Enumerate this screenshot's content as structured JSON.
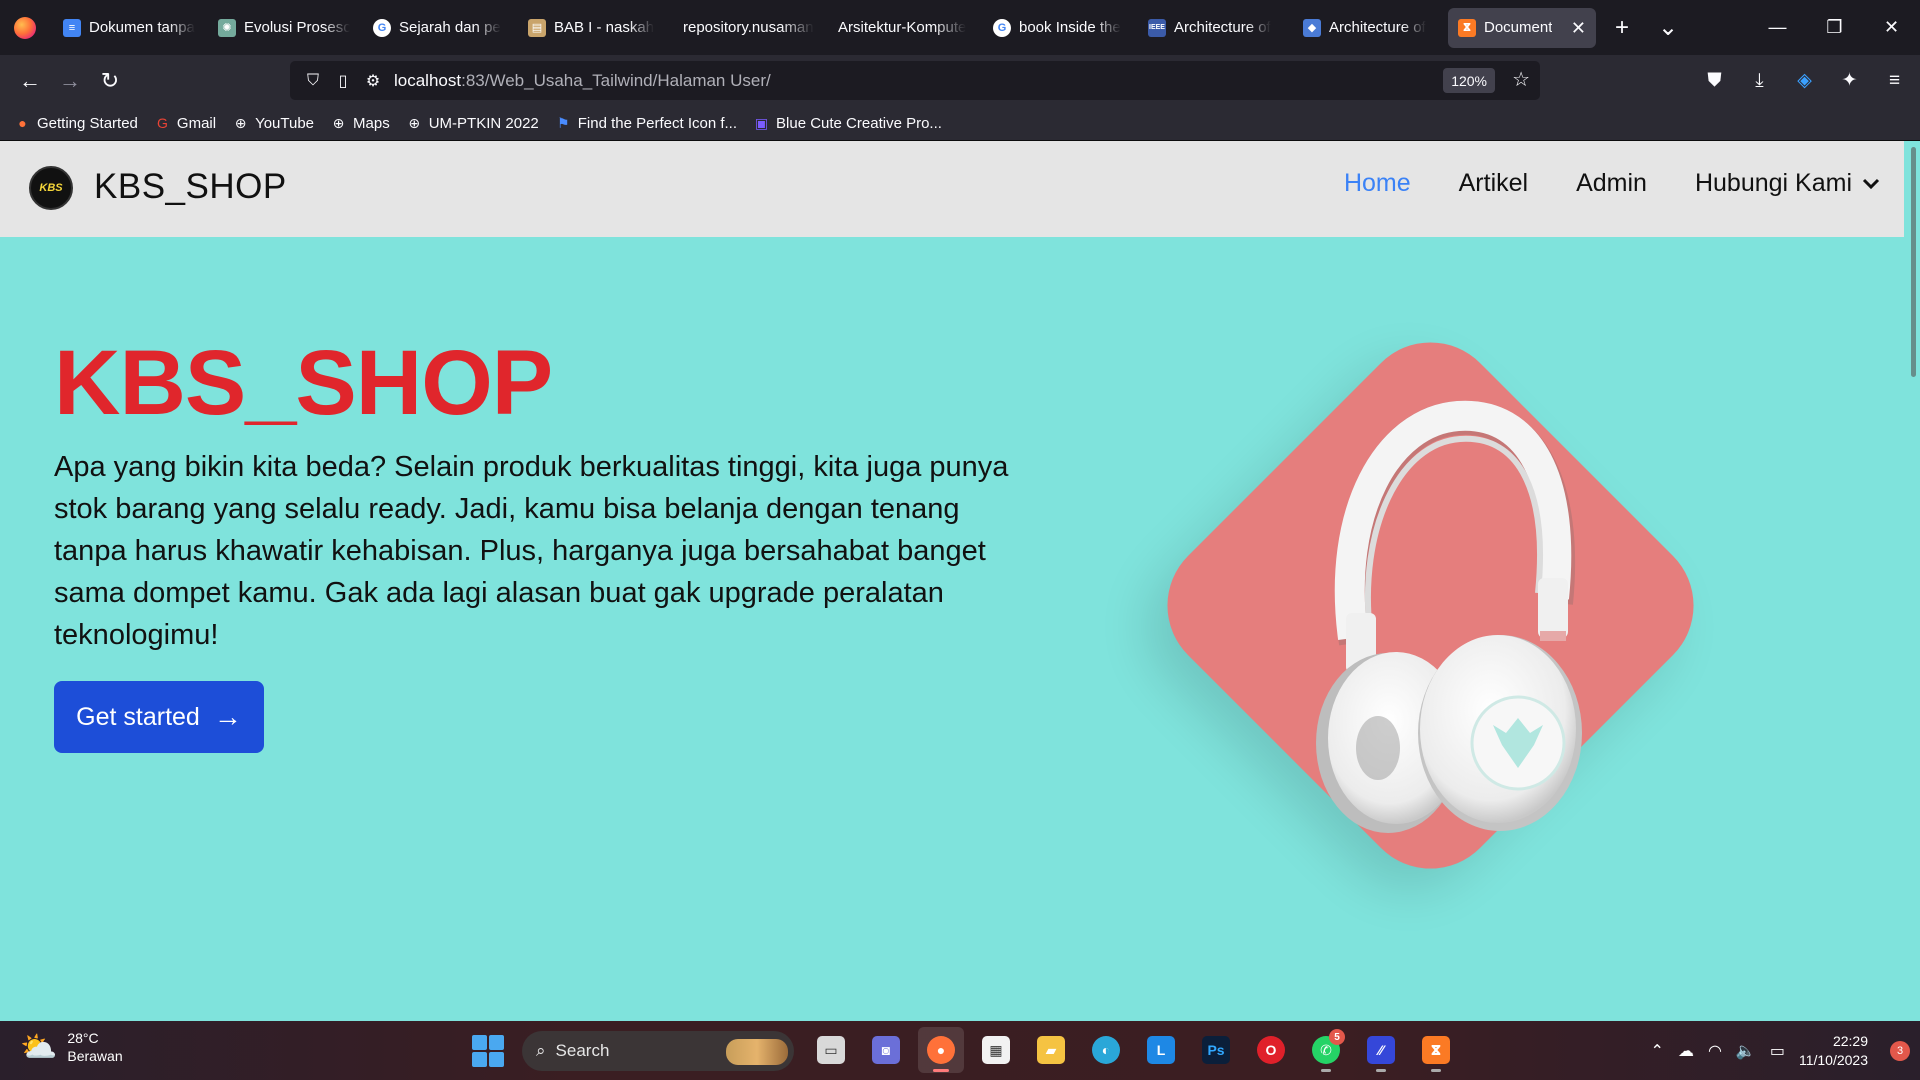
{
  "browser": {
    "tabs": [
      {
        "title": "Dokumen tanpa",
        "icon": "google-docs-icon",
        "color": "#4285f4",
        "glyph": "≡"
      },
      {
        "title": "Evolusi Proseso",
        "icon": "chatgpt-icon",
        "color": "#74aa9c",
        "glyph": "✺"
      },
      {
        "title": "Sejarah dan pe",
        "icon": "google-icon",
        "color": "#ffffff",
        "glyph": "G"
      },
      {
        "title": "BAB I - naskah",
        "icon": "document-thumb-icon",
        "color": "#c9a46b",
        "glyph": "▤"
      },
      {
        "title": "repository.nusaman",
        "icon": "",
        "color": "",
        "glyph": ""
      },
      {
        "title": "Arsitektur-Kompute",
        "icon": "",
        "color": "",
        "glyph": ""
      },
      {
        "title": "book Inside the",
        "icon": "google-icon",
        "color": "#ffffff",
        "glyph": "G"
      },
      {
        "title": "Architecture of",
        "icon": "ieee-icon",
        "color": "#3b5ba9",
        "glyph": "IEEE"
      },
      {
        "title": "Architecture of",
        "icon": "diamond-site-icon",
        "color": "#4a7bd6",
        "glyph": "◆"
      }
    ],
    "active_tab": {
      "title": "Document",
      "icon": "xampp-icon",
      "color": "#fb7a24",
      "glyph": "ⴵ"
    },
    "url_host": "localhost",
    "url_path": ":83/Web_Usaha_Tailwind/Halaman User/",
    "zoom": "120%",
    "bookmarks": [
      {
        "label": "Getting Started",
        "icon": "firefox-icon",
        "glyph": "●"
      },
      {
        "label": "Gmail",
        "icon": "google-icon",
        "glyph": "G"
      },
      {
        "label": "YouTube",
        "icon": "globe-icon",
        "glyph": "⊕"
      },
      {
        "label": "Maps",
        "icon": "globe-icon",
        "glyph": "⊕"
      },
      {
        "label": "UM-PTKIN 2022",
        "icon": "globe-icon",
        "glyph": "⊕"
      },
      {
        "label": "Find the Perfect Icon f...",
        "icon": "flag-icon",
        "glyph": "⚑"
      },
      {
        "label": "Blue Cute Creative Pro...",
        "icon": "canva-icon",
        "glyph": "▣"
      }
    ]
  },
  "site": {
    "brand": "KBS_SHOP",
    "logo_text": "KBS",
    "nav": {
      "home": "Home",
      "artikel": "Artikel",
      "admin": "Admin",
      "hubungi": "Hubungi Kami"
    },
    "hero_title": "KBS_SHOP",
    "hero_text": "Apa yang bikin kita beda? Selain produk berkualitas tinggi, kita juga punya stok barang yang selalu ready. Jadi, kamu bisa belanja dengan tenang tanpa harus khawatir kehabisan. Plus, harganya juga bersahabat banget sama dompet kamu. Gak ada lagi alasan buat gak upgrade peralatan teknologimu!",
    "cta": "Get started",
    "colors": {
      "accent_nav": "#3b82f6",
      "title": "#e0262c",
      "cta": "#1d4ed8",
      "hero_bg": "#7fe3dc",
      "diamond": "#e57e7d"
    },
    "product_image": "white-headphones"
  },
  "taskbar": {
    "weather_temp": "28°C",
    "weather_desc": "Berawan",
    "search_label": "Search",
    "apps": [
      {
        "name": "task-view",
        "color": "#d9d9d9",
        "glyph": "▭",
        "badge": ""
      },
      {
        "name": "teams-meet",
        "color": "#6b6fd8",
        "glyph": "◙",
        "badge": ""
      },
      {
        "name": "firefox",
        "color": "#ff7139",
        "glyph": "●",
        "badge": ""
      },
      {
        "name": "microsoft-store",
        "color": "#f2f2f2",
        "glyph": "▦",
        "badge": ""
      },
      {
        "name": "file-explorer",
        "color": "#f5c342",
        "glyph": "▰",
        "badge": ""
      },
      {
        "name": "edge",
        "color": "#2aa7d8",
        "glyph": "◐",
        "badge": ""
      },
      {
        "name": "launcher-l",
        "color": "#1e88e5",
        "glyph": "L",
        "badge": ""
      },
      {
        "name": "photoshop",
        "color": "#0b1f3a",
        "glyph": "Ps",
        "badge": ""
      },
      {
        "name": "opera",
        "color": "#e0202a",
        "glyph": "O",
        "badge": ""
      },
      {
        "name": "whatsapp",
        "color": "#25d366",
        "glyph": "✆",
        "badge": "5"
      },
      {
        "name": "pen-app",
        "color": "#3547d9",
        "glyph": "⁄⁄",
        "badge": ""
      },
      {
        "name": "xampp",
        "color": "#fb7a24",
        "glyph": "ⴵ",
        "badge": ""
      }
    ],
    "time": "22:29",
    "date": "11/10/2023",
    "notifications": "3"
  }
}
